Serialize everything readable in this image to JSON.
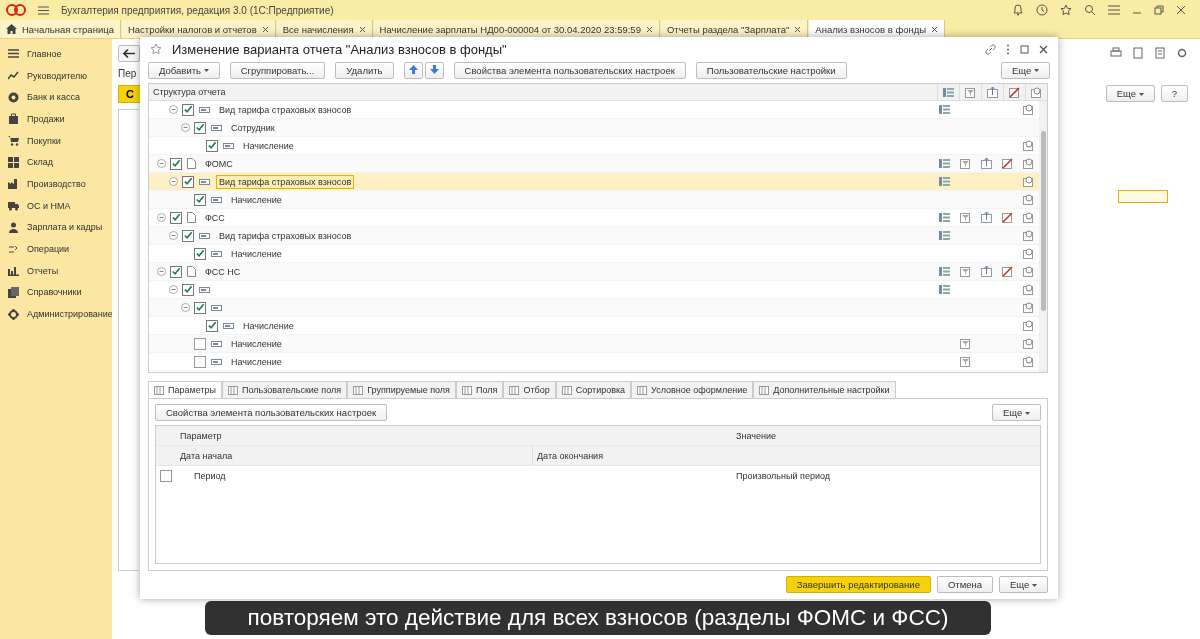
{
  "app": {
    "title": "Бухгалтерия предприятия, редакция 3.0  (1С:Предприятие)"
  },
  "open_tabs": [
    {
      "label": "Начальная страница",
      "kind": "home",
      "selected": false
    },
    {
      "label": "Настройки налогов и отчетов",
      "kind": "doc",
      "selected": false
    },
    {
      "label": "Все начисления",
      "kind": "doc",
      "selected": false
    },
    {
      "label": "Начисление зарплаты НД00-000004 от 30.04.2020 23:59:59",
      "kind": "doc",
      "selected": false
    },
    {
      "label": "Отчеты раздела \"Зарплата\"",
      "kind": "doc",
      "selected": false
    },
    {
      "label": "Анализ взносов в фонды",
      "kind": "doc",
      "selected": true
    }
  ],
  "sidebar": {
    "items": [
      {
        "label": "Главное"
      },
      {
        "label": "Руководителю"
      },
      {
        "label": "Банк и касса"
      },
      {
        "label": "Продажи"
      },
      {
        "label": "Покупки"
      },
      {
        "label": "Склад"
      },
      {
        "label": "Производство"
      },
      {
        "label": "ОС и НМА"
      },
      {
        "label": "Зарплата и кадры"
      },
      {
        "label": "Операции"
      },
      {
        "label": "Отчеты"
      },
      {
        "label": "Справочники"
      },
      {
        "label": "Администрирование"
      }
    ]
  },
  "background_form": {
    "title": "Пер",
    "button": "С",
    "more_button": "Еще",
    "help_button": "?"
  },
  "dialog": {
    "title": "Изменение варианта отчета \"Анализ взносов в фонды\"",
    "toolbar": {
      "add": "Добавить",
      "group": "Сгруппировать...",
      "delete": "Удалить",
      "properties": "Свойства элемента пользовательских настроек",
      "user_settings": "Пользовательские настройки",
      "more": "Еще"
    },
    "tree": {
      "header": "Структура отчета",
      "rows": [
        {
          "children": [
            {
              "label": "Вид тарифа страховых взносов",
              "kind": "field",
              "checked": true,
              "expanded": true,
              "selected": false,
              "marks": [
                true,
                false,
                false,
                false,
                true
              ],
              "children": [
                {
                  "label": "Сотрудник",
                  "kind": "field",
                  "checked": true,
                  "expanded": true,
                  "selected": false,
                  "marks": [
                    false,
                    false,
                    false,
                    false,
                    false
                  ],
                  "children": [
                    {
                      "label": "Начисление",
                      "kind": "field",
                      "checked": true,
                      "selected": false,
                      "marks": [
                        false,
                        false,
                        false,
                        false,
                        true
                      ]
                    }
                  ]
                }
              ]
            }
          ]
        },
        {
          "label": "ФОМС",
          "kind": "group",
          "checked": true,
          "expanded": true,
          "selected": false,
          "marks": [
            true,
            true,
            true,
            true,
            true
          ],
          "children": [
            {
              "label": "Вид тарифа страховых взносов",
              "kind": "field",
              "checked": true,
              "expanded": true,
              "selected": true,
              "marks": [
                true,
                false,
                false,
                false,
                true
              ],
              "children": [
                {
                  "label": "Начисление",
                  "kind": "field",
                  "checked": true,
                  "selected": false,
                  "marks": [
                    false,
                    false,
                    false,
                    false,
                    true
                  ]
                }
              ]
            }
          ]
        },
        {
          "label": "ФСС",
          "kind": "group",
          "checked": true,
          "expanded": true,
          "selected": false,
          "marks": [
            true,
            true,
            true,
            true,
            true
          ],
          "children": [
            {
              "label": "Вид тарифа страховых взносов",
              "kind": "field",
              "checked": true,
              "expanded": true,
              "selected": false,
              "marks": [
                true,
                false,
                false,
                false,
                true
              ],
              "children": [
                {
                  "label": "Начисление",
                  "kind": "field",
                  "checked": true,
                  "selected": false,
                  "marks": [
                    false,
                    false,
                    false,
                    false,
                    true
                  ]
                }
              ]
            }
          ]
        },
        {
          "label": "ФСС НС",
          "kind": "group",
          "checked": true,
          "expanded": true,
          "selected": false,
          "marks": [
            true,
            true,
            true,
            true,
            true
          ],
          "children": [
            {
              "kind": "field",
              "checked": true,
              "expanded": true,
              "selected": false,
              "marks": [
                true,
                false,
                false,
                false,
                true
              ],
              "children": [
                {
                  "kind": "field",
                  "checked": true,
                  "expanded": true,
                  "selected": false,
                  "marks": [
                    false,
                    false,
                    false,
                    false,
                    true
                  ],
                  "children": [
                    {
                      "label": "Начисление",
                      "kind": "field",
                      "checked": true,
                      "selected": false,
                      "marks": [
                        false,
                        false,
                        false,
                        false,
                        true
                      ]
                    }
                  ]
                },
                {
                  "label": "Начисление",
                  "kind": "field",
                  "checked": false,
                  "selected": false,
                  "marks": [
                    false,
                    true,
                    false,
                    false,
                    true
                  ]
                },
                {
                  "label": "Начисление",
                  "kind": "field",
                  "checked": false,
                  "selected": false,
                  "marks": [
                    false,
                    true,
                    false,
                    false,
                    true
                  ]
                }
              ]
            }
          ]
        }
      ]
    },
    "tabs": [
      {
        "label": "Параметры",
        "selected": true
      },
      {
        "label": "Пользовательские поля",
        "selected": false
      },
      {
        "label": "Группируемые поля",
        "selected": false
      },
      {
        "label": "Поля",
        "selected": false
      },
      {
        "label": "Отбор",
        "selected": false
      },
      {
        "label": "Сортировка",
        "selected": false
      },
      {
        "label": "Условное оформление",
        "selected": false
      },
      {
        "label": "Дополнительные настройки",
        "selected": false
      }
    ],
    "params": {
      "properties_button": "Свойства элемента пользовательских настроек",
      "more": "Еще",
      "columns": [
        "Параметр",
        "Значение"
      ],
      "subcolumns": [
        "Дата начала",
        "Дата окончания"
      ],
      "rows": [
        {
          "checked": false,
          "name": "Период",
          "value": "Произвольный период"
        }
      ]
    },
    "footer": {
      "finish": "Завершить редактирование",
      "cancel": "Отмена",
      "more": "Еще"
    }
  },
  "subtitle": "повторяем это действие для всех взносов (разделы ФОМС и ФСС)"
}
